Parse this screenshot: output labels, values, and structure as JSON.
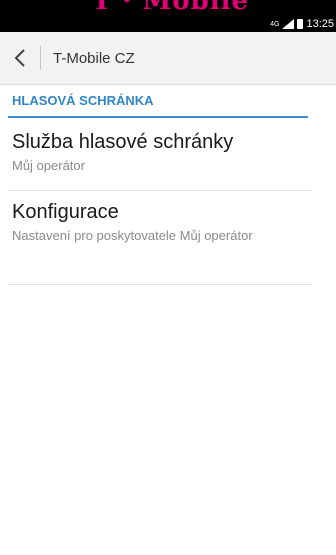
{
  "brand": {
    "text": "T · Mobile"
  },
  "status_bar": {
    "network": "4G",
    "time": "13:25"
  },
  "action_bar": {
    "title": "T-Mobile CZ"
  },
  "section": {
    "header": "HLASOVÁ SCHRÁNKA"
  },
  "items": [
    {
      "title": "Služba hlasové schránky",
      "subtitle": "Můj operátor"
    },
    {
      "title": "Konfigurace",
      "subtitle": "Nastavení pro poskytovatele Můj operátor"
    }
  ],
  "colors": {
    "accent": "#2f86c8",
    "brand": "#e20074"
  }
}
